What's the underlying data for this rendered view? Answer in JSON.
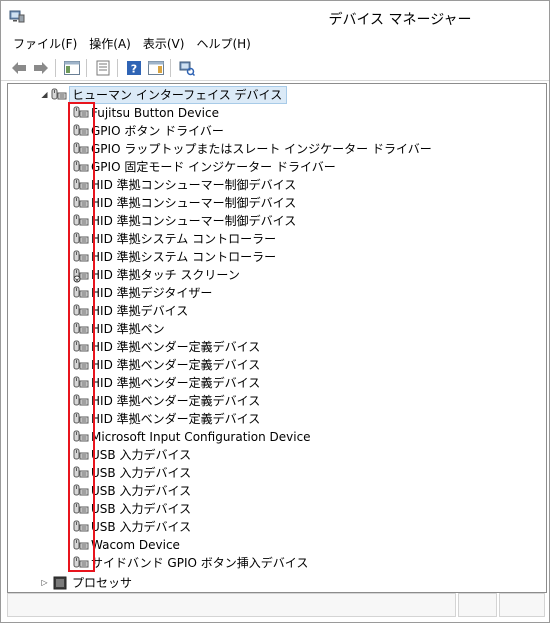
{
  "window": {
    "title": "デバイス マネージャー"
  },
  "menu": [
    "ファイル(F)",
    "操作(A)",
    "表示(V)",
    "ヘルプ(H)"
  ],
  "toolbar": {
    "buttons": [
      "back-arrow-icon",
      "forward-arrow-icon",
      "show-hide-console-tree-icon",
      "properties-icon",
      "help-icon",
      "action-pane-icon",
      "scan-hardware-icon"
    ]
  },
  "tree": {
    "category": {
      "label": "ヒューマン インターフェイス デバイス",
      "expanded": true
    },
    "devices": [
      "Fujitsu Button Device",
      "GPIO ボタン ドライバー",
      "GPIO ラップトップまたはスレート インジケーター ドライバー",
      "GPIO 固定モード インジケーター ドライバー",
      "HID 準拠コンシューマー制御デバイス",
      "HID 準拠コンシューマー制御デバイス",
      "HID 準拠コンシューマー制御デバイス",
      "HID 準拠システム コントローラー",
      "HID 準拠システム コントローラー",
      "HID 準拠タッチ スクリーン",
      "HID 準拠デジタイザー",
      "HID 準拠デバイス",
      "HID 準拠ペン",
      "HID 準拠ベンダー定義デバイス",
      "HID 準拠ベンダー定義デバイス",
      "HID 準拠ベンダー定義デバイス",
      "HID 準拠ベンダー定義デバイス",
      "HID 準拠ベンダー定義デバイス",
      "Microsoft Input Configuration Device",
      "USB 入力デバイス",
      "USB 入力デバイス",
      "USB 入力デバイス",
      "USB 入力デバイス",
      "USB 入力デバイス",
      "Wacom Device",
      "サイドバンド GPIO ボタン挿入デバイス"
    ],
    "next_category": {
      "label": "プロセッサ",
      "expanded": false
    }
  },
  "colors": {
    "highlight_border": "#e8141d",
    "selection_bg": "#dbeaf7"
  }
}
